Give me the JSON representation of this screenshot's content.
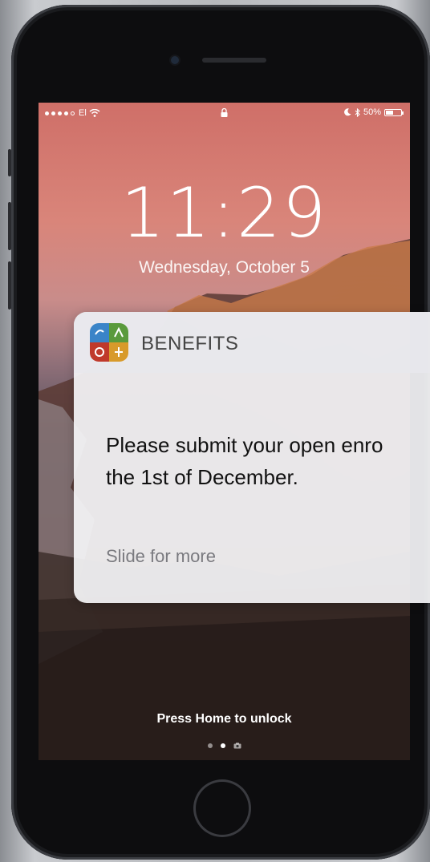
{
  "status_bar": {
    "carrier": "El",
    "battery_text": "50%",
    "battery_level": 0.5,
    "icons": [
      "signal-dots",
      "wifi-icon",
      "lock-icon",
      "moon-icon",
      "bluetooth-icon",
      "battery-icon"
    ]
  },
  "lock_screen": {
    "time": "11:29",
    "date": "Wednesday, October 5",
    "unlock_hint": "Press Home to unlock"
  },
  "notification": {
    "app_name": "BENEFITS",
    "body_line1": "Please submit your open enro",
    "body_line2": "the 1st of December.",
    "hint": "Slide for more"
  },
  "colors": {
    "notification_bg": "#f4f4f6",
    "app_icon_blue": "#3a84c8",
    "app_icon_green": "#5a9a3c",
    "app_icon_red": "#c0392b",
    "app_icon_gold": "#d89a2a"
  }
}
